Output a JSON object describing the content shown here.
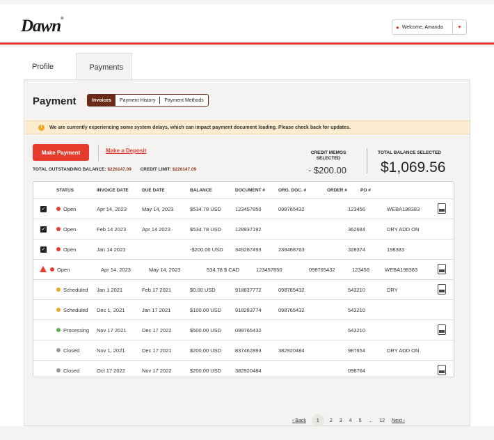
{
  "header": {
    "logo": "Dawn",
    "logo_mark": "®",
    "welcome": "Welcome, Amanda",
    "user_icon": "user-icon",
    "caret_icon": "chevron-down-icon"
  },
  "tabs": [
    {
      "label": "Profile"
    },
    {
      "label": "Payments"
    }
  ],
  "payment": {
    "title": "Payment",
    "segments": [
      "Invoices",
      "Payment History",
      "Payment Methods"
    ],
    "alert": "We are currently experiencing some system delays, which can impact payment document loading. Please check back for updates.",
    "make_payment": "Make Payment",
    "make_deposit": "Make a Deposit",
    "outstanding_label": "TOTAL OUTSTANDING BALANCE:",
    "outstanding_value": "$226147.09",
    "credit_limit_label": "CREDIT LIMIT:",
    "credit_limit_value": "$226147.09",
    "credit_memos_label": "CREDIT MEMOS SELECTED",
    "credit_memos_value": "- $200.00",
    "total_selected_label": "TOTAL BALANCE SELECTED",
    "total_selected_value": "$1,069.56"
  },
  "table": {
    "headers": [
      "STATUS",
      "INVOICE DATE",
      "DUE DATE",
      "BALANCE",
      "DOCUMENT #",
      "ORG. DOC. #",
      "ORDER #",
      "PO #"
    ],
    "rows": [
      {
        "status": "Open",
        "invoice_date": "Apr 14, 2023",
        "due_date": "May 14, 2023",
        "balance": "$534.78 USD",
        "document": "123457850",
        "org_doc": "098765432",
        "order": "123456",
        "po": "WEBA198383"
      },
      {
        "status": "Open",
        "invoice_date": "Feb 14 2023",
        "due_date": "Apr 14 2023",
        "balance": "$534.78 USD",
        "document": "128937192",
        "org_doc": "",
        "order": "362684",
        "po": "DRY ADD ON"
      },
      {
        "status": "Open",
        "invoice_date": "Jan 14 2023",
        "due_date": "",
        "balance": "-$200.00 USD",
        "document": "349287493",
        "org_doc": "238468763",
        "order": "328374",
        "po": "198383"
      },
      {
        "status": "Open",
        "invoice_date": "Apr 14, 2023",
        "due_date": "May 14, 2023",
        "balance": "534,78 $ CAD",
        "document": "123457850",
        "org_doc": "098765432",
        "order": "123456",
        "po": "WEBA198383"
      },
      {
        "status": "Scheduled",
        "invoice_date": "Jan 1 2021",
        "due_date": "Feb 17 2021",
        "balance": "$0.00 USD",
        "document": "918837772",
        "org_doc": "098765432",
        "order": "543210",
        "po": "DRY"
      },
      {
        "status": "Scheduled",
        "invoice_date": "Dec 1, 2021",
        "due_date": "Jan 17 2021",
        "balance": "$100.00 USD",
        "document": "918283774",
        "org_doc": "098765432",
        "order": "543210",
        "po": ""
      },
      {
        "status": "Processing",
        "invoice_date": "Nov 17 2021",
        "due_date": "Dec 17 2022",
        "balance": "$500.00 USD",
        "document": "098765432",
        "org_doc": "",
        "order": "543210",
        "po": ""
      },
      {
        "status": "Closed",
        "invoice_date": "Nov 1, 2021",
        "due_date": "Dec 17 2021",
        "balance": "$200.00 USD",
        "document": "837462893",
        "org_doc": "382920484",
        "order": "987654",
        "po": "DRY ADD ON"
      },
      {
        "status": "Closed",
        "invoice_date": "Oct 17 2022",
        "due_date": "Nov 17 2022",
        "balance": "$200.00 USD",
        "document": "382920484",
        "org_doc": "",
        "order": "098764",
        "po": ""
      }
    ],
    "status_colors": {
      "Open": "#e53b2c",
      "Scheduled": "#f0a828",
      "Processing": "#5bb04a",
      "Closed": "#999999"
    }
  },
  "pagination": {
    "back": "Back",
    "next": "Next",
    "prev_arrow": "‹",
    "next_arrow": "›",
    "pages": [
      "1",
      "2",
      "3",
      "4",
      "5",
      "...",
      "12"
    ],
    "current": "1"
  }
}
